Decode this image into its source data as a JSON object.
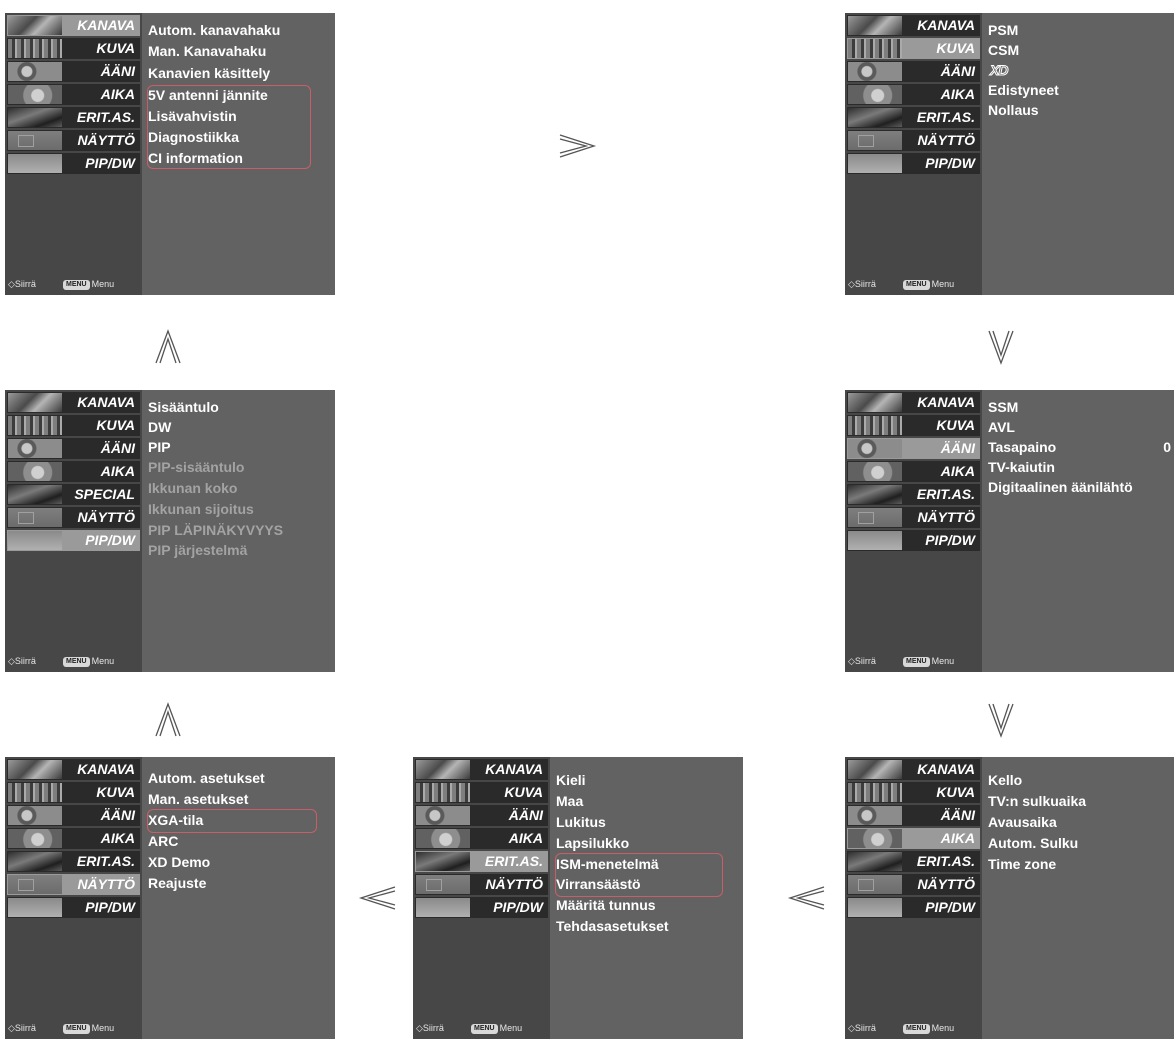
{
  "side_labels": [
    "KANAVA",
    "KUVA",
    "ÄÄNI",
    "AIKA",
    "ERIT.AS.",
    "NÄYTTÖ",
    "PIP/DW"
  ],
  "side_labels_pip": [
    "KANAVA",
    "KUVA",
    "ÄÄNI",
    "AIKA",
    "SPECIAL",
    "NÄYTTÖ",
    "PIP/DW"
  ],
  "hint": {
    "nav": "Siirrä",
    "menu_badge": "MENU",
    "menu": "Menu"
  },
  "screens": {
    "kanava": {
      "items": [
        "Autom. kanavahaku",
        "Man. Kanavahaku",
        "Kanavien käsittely",
        "5V antenni jännite",
        "Lisävahvistin",
        "Diagnostiikka",
        "CI information"
      ]
    },
    "kuva": {
      "items": [
        "PSM",
        "CSM",
        "XD",
        "Edistyneet",
        "Nollaus"
      ]
    },
    "aani": {
      "items": [
        "SSM",
        "AVL",
        "Tasapaino",
        "TV-kaiutin",
        "Digitaalinen äänilähtö"
      ],
      "balance_value": "0"
    },
    "aika": {
      "items": [
        "Kello",
        "TV:n sulkuaika",
        "Avausaika",
        "Autom. Sulku",
        "Time zone"
      ]
    },
    "erit": {
      "items": [
        "Kieli",
        "Maa",
        "Lukitus",
        "Lapsilukko",
        "ISM-menetelmä",
        "Virransäästö",
        "Määritä tunnus",
        "Tehdasasetukset"
      ]
    },
    "naytto": {
      "items": [
        "Autom. asetukset",
        "Man. asetukset",
        "XGA-tila",
        "ARC",
        "XD Demo",
        "Reajuste"
      ]
    },
    "pip": {
      "items": [
        "Sisääntulo",
        "DW",
        "PIP",
        "PIP-sisääntulo",
        "Ikkunan koko",
        "Ikkunan sijoitus",
        "PIP LÄPINÄKYVYYS",
        "PIP järjestelmä"
      ]
    }
  },
  "arrows": [
    "right",
    "down",
    "down",
    "left",
    "left",
    "up",
    "up"
  ]
}
